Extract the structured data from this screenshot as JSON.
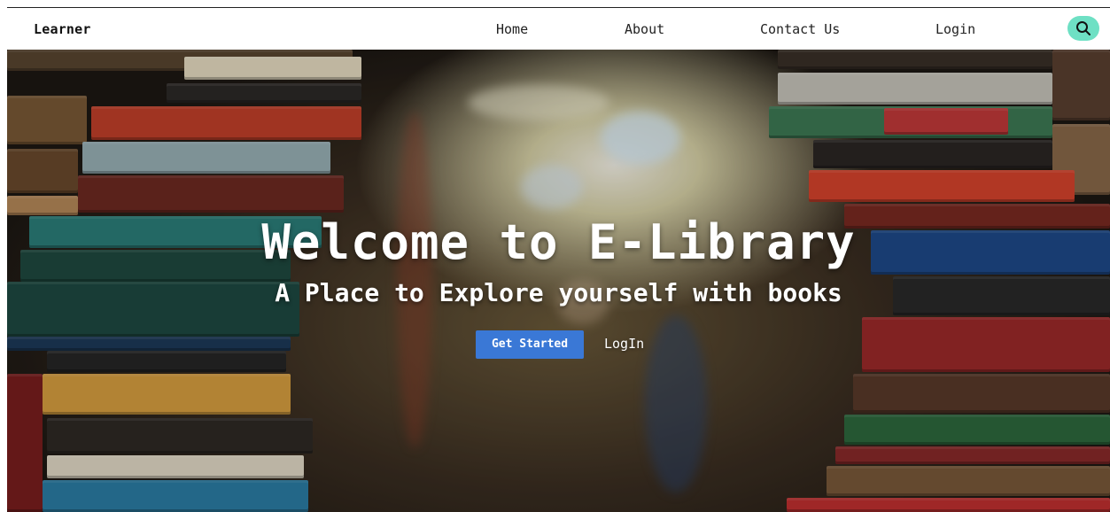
{
  "navbar": {
    "brand": "Learner",
    "links": [
      "Home",
      "About",
      "Contact Us",
      "Login"
    ],
    "search_icon": "search-icon",
    "search_bg": "#6ee0c4"
  },
  "hero": {
    "title": "Welcome to E-Library",
    "subtitle": "A Place to Explore yourself with books",
    "primary_button": "Get Started",
    "secondary_button": "LogIn",
    "primary_color": "#3a78d6"
  }
}
